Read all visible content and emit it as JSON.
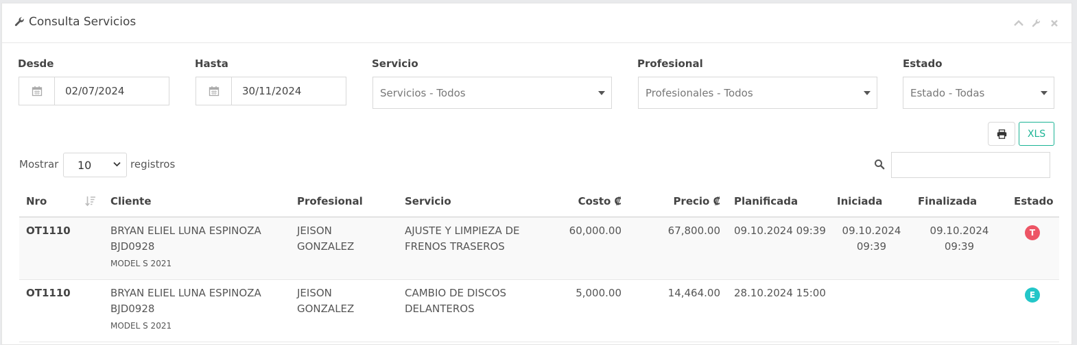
{
  "panel": {
    "title": "Consulta Servicios"
  },
  "filters": {
    "desde": {
      "label": "Desde",
      "value": "02/07/2024"
    },
    "hasta": {
      "label": "Hasta",
      "value": "30/11/2024"
    },
    "servicio": {
      "label": "Servicio",
      "value": "Servicios - Todos"
    },
    "profesional": {
      "label": "Profesional",
      "value": "Profesionales - Todos"
    },
    "estado": {
      "label": "Estado",
      "value": "Estado - Todas"
    }
  },
  "toolbar": {
    "xls_label": "XLS"
  },
  "length": {
    "show_label": "Mostrar",
    "value": "10",
    "records_label": "registros"
  },
  "table": {
    "headers": {
      "nro": "Nro",
      "cliente": "Cliente",
      "profesional": "Profesional",
      "servicio": "Servicio",
      "costo": "Costo ₡",
      "precio": "Precio ₡",
      "planificada": "Planificada",
      "iniciada": "Iniciada",
      "finalizada": "Finalizada",
      "estado": "Estado"
    },
    "rows": [
      {
        "nro": "OT1110",
        "cliente_name": "BRYAN ELIEL LUNA ESPINOZA",
        "cliente_plate": "BJD0928",
        "cliente_model": "MODEL S 2021",
        "profesional_1": "JEISON",
        "profesional_2": "GONZALEZ",
        "servicio_1": "AJUSTE Y LIMPIEZA DE",
        "servicio_2": "FRENOS TRASEROS",
        "costo": "60,000.00",
        "precio": "67,800.00",
        "planificada": "09.10.2024 09:39",
        "iniciada_1": "09.10.2024",
        "iniciada_2": "09:39",
        "finalizada_1": "09.10.2024",
        "finalizada_2": "09:39",
        "estado": "T",
        "estado_color": "#ed5565"
      },
      {
        "nro": "OT1110",
        "cliente_name": "BRYAN ELIEL LUNA ESPINOZA",
        "cliente_plate": "BJD0928",
        "cliente_model": "MODEL S 2021",
        "profesional_1": "JEISON",
        "profesional_2": "GONZALEZ",
        "servicio_1": "CAMBIO DE DISCOS",
        "servicio_2": "DELANTEROS",
        "costo": "5,000.00",
        "precio": "14,464.00",
        "planificada": "28.10.2024 15:00",
        "iniciada_1": "",
        "iniciada_2": "",
        "finalizada_1": "",
        "finalizada_2": "",
        "estado": "E",
        "estado_color": "#23c6c8"
      }
    ]
  }
}
